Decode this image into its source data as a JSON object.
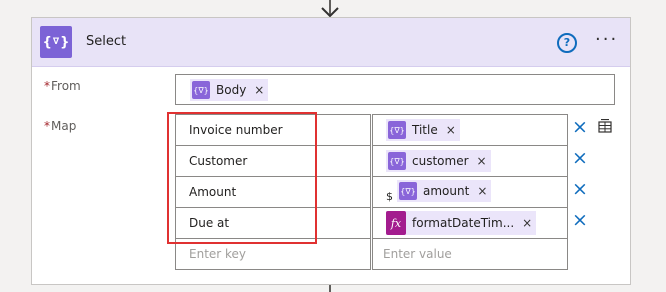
{
  "action": {
    "title": "Select",
    "icon": "curly-braces-variable-icon",
    "help_glyph": "?",
    "more_glyph": "···"
  },
  "from": {
    "label": "From",
    "required_marker": "*",
    "token": {
      "label": "Body",
      "icon": "dynamic-content-icon",
      "remove_glyph": "×"
    }
  },
  "map": {
    "label": "Map",
    "required_marker": "*",
    "rows": [
      {
        "key": "Invoice number",
        "value": {
          "label": "Title",
          "icon": "dynamic-content-icon",
          "remove_glyph": "×"
        }
      },
      {
        "key": "Customer",
        "value": {
          "label": "customer",
          "icon": "dynamic-content-icon",
          "remove_glyph": "×"
        }
      },
      {
        "key": "Amount",
        "prefix": "$",
        "value": {
          "label": "amount",
          "icon": "dynamic-content-icon",
          "remove_glyph": "×"
        }
      },
      {
        "key": "Due at",
        "value": {
          "label": "formatDateTim...",
          "icon": "expression-fx-icon",
          "icon_glyph": "fx",
          "remove_glyph": "×"
        }
      }
    ],
    "new_row": {
      "key_placeholder": "Enter key",
      "value_placeholder": "Enter value"
    },
    "delete_glyph": "×",
    "switch_mode_icon": "text-table-mode-icon"
  },
  "colors": {
    "header_bg": "#e8e3f7",
    "action_icon": "#7c63d6",
    "token_bg": "#ebe5fa",
    "expression_icon": "#a31c8e",
    "link_blue": "#0f6cbd",
    "highlight_red": "#e03131"
  }
}
